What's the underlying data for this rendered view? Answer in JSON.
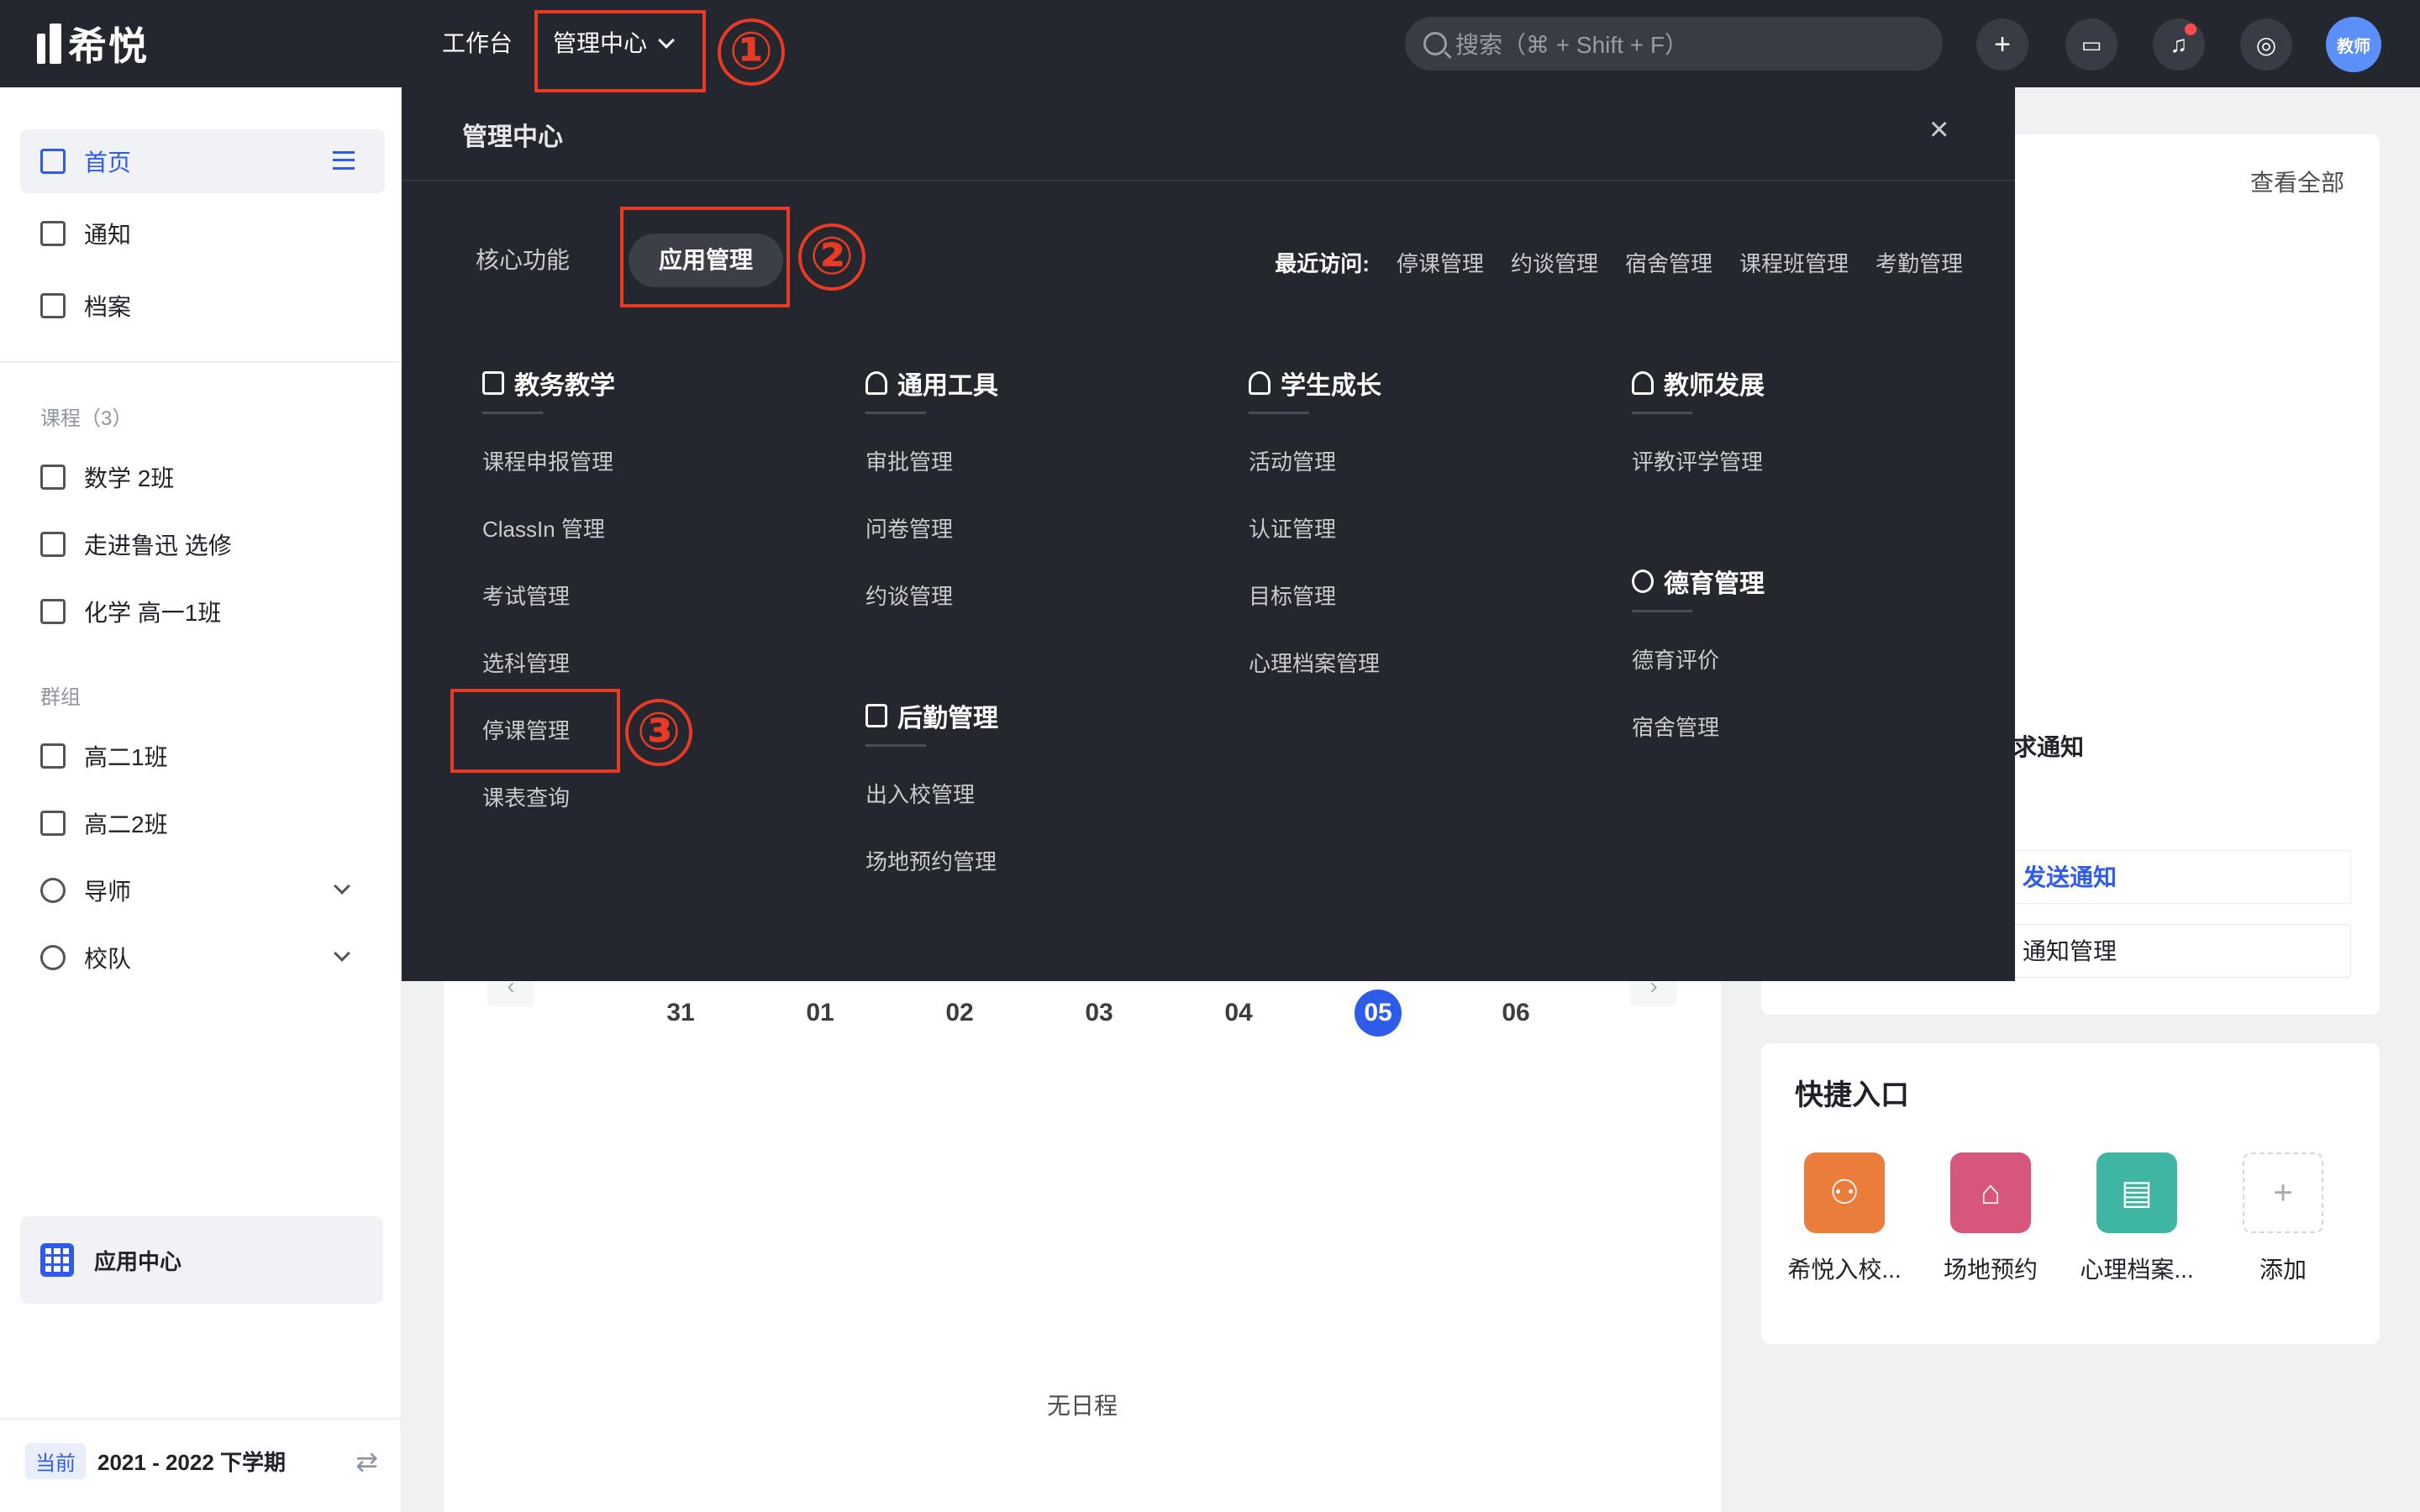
{
  "app": {
    "logo_text": "希悦"
  },
  "topnav": {
    "workbench": "工作台",
    "manage_center": "管理中心",
    "search_placeholder": "搜索（⌘ + Shift + F）",
    "avatar_label": "教师"
  },
  "sidebar": {
    "main_items": [
      {
        "label": "首页",
        "icon": "home-icon"
      },
      {
        "label": "通知",
        "icon": "message-icon"
      },
      {
        "label": "档案",
        "icon": "archive-icon"
      }
    ],
    "courses_title": "课程（3）",
    "courses": [
      "数学 2班",
      "走进鲁迅 选修",
      "化学 高一1班"
    ],
    "groups_title": "群组",
    "groups": [
      "高二1班",
      "高二2班"
    ],
    "collapsibles": [
      "导师",
      "校队"
    ],
    "app_center": "应用中心",
    "semester_badge": "当前",
    "semester": "2021 - 2022 下学期"
  },
  "panel": {
    "title": "管理中心",
    "tabs": [
      "核心功能",
      "应用管理"
    ],
    "recent_label": "最近访问:",
    "recent_items": [
      "停课管理",
      "约谈管理",
      "宿舍管理",
      "课程班管理",
      "考勤管理"
    ],
    "columns": [
      {
        "title": "教务教学",
        "icon": "document-icon",
        "items": [
          "课程申报管理",
          "ClassIn 管理",
          "考试管理",
          "选科管理",
          "停课管理",
          "课表查询"
        ]
      },
      {
        "title": "通用工具",
        "icon": "wrench-icon",
        "items": [
          "审批管理",
          "问卷管理",
          "约谈管理"
        ]
      },
      {
        "title": "学生成长",
        "icon": "user-icon",
        "items": [
          "活动管理",
          "认证管理",
          "目标管理",
          "心理档案管理"
        ]
      },
      {
        "title": "教师发展",
        "icon": "teacher-icon",
        "items": [
          "评教评学管理"
        ]
      }
    ],
    "logistics": {
      "title": "后勤管理",
      "icon": "bookmark-icon",
      "items": [
        "出入校管理",
        "场地预约管理"
      ]
    },
    "moral": {
      "title": "德育管理",
      "icon": "flower-icon",
      "items": [
        "德育评价",
        "宿舍管理"
      ]
    }
  },
  "calendar": {
    "days": [
      "31",
      "01",
      "02",
      "03",
      "04",
      "05",
      "06"
    ],
    "today": "05",
    "empty": "无日程"
  },
  "right": {
    "view_all": "查看全部",
    "request_notice": "求通知",
    "send_notice": "发送通知",
    "notice_manage": "通知管理",
    "quick_title": "快捷入口",
    "quick_items": [
      {
        "label": "希悦入校...",
        "color": "#ea7d3b"
      },
      {
        "label": "场地预约",
        "color": "#d6577b"
      },
      {
        "label": "心理档案...",
        "color": "#3fb5a3"
      },
      {
        "label": "添加",
        "color": ""
      }
    ]
  },
  "annotations": [
    "①",
    "②",
    "③"
  ]
}
